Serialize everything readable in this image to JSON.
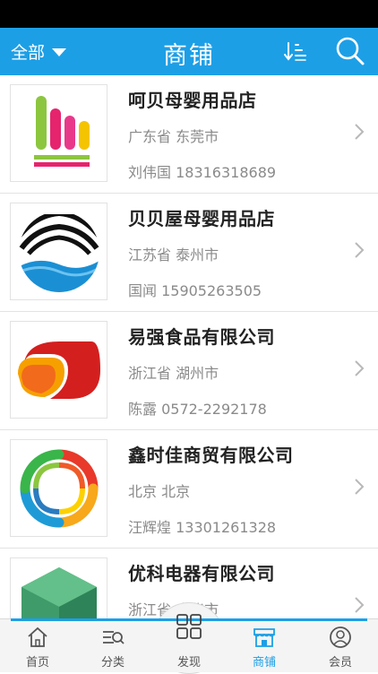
{
  "header": {
    "filter_label": "全部",
    "title": "商铺",
    "sort_icon": "sort-icon",
    "search_icon": "search-icon"
  },
  "shops": [
    {
      "name": "呵贝母婴用品店",
      "region": "广东省 东莞市",
      "contact": "刘伟国  18316318689",
      "logo": "bars-logo"
    },
    {
      "name": "贝贝屋母婴用品店",
      "region": "江苏省 泰州市",
      "contact": "国闻 15905263505",
      "logo": "wave-logo"
    },
    {
      "name": "易强食品有限公司",
      "region": "浙江省 湖州市",
      "contact": "陈露 0572-2292178",
      "logo": "swirl-logo"
    },
    {
      "name": "鑫时佳商贸有限公司",
      "region": "北京 北京",
      "contact": "汪辉煌 13301261328",
      "logo": "rings-logo"
    },
    {
      "name": "优科电器有限公司",
      "region": "浙江省 金华市",
      "contact": "",
      "logo": "cube-logo"
    }
  ],
  "tabs": [
    {
      "label": "首页",
      "icon": "home-icon"
    },
    {
      "label": "分类",
      "icon": "category-icon"
    },
    {
      "label": "发现",
      "icon": "grid-icon"
    },
    {
      "label": "商铺",
      "icon": "shop-icon",
      "active": true
    },
    {
      "label": "会员",
      "icon": "user-icon"
    }
  ],
  "colors": {
    "accent": "#1d9fe6",
    "header_bg": "#1d9fe6"
  }
}
